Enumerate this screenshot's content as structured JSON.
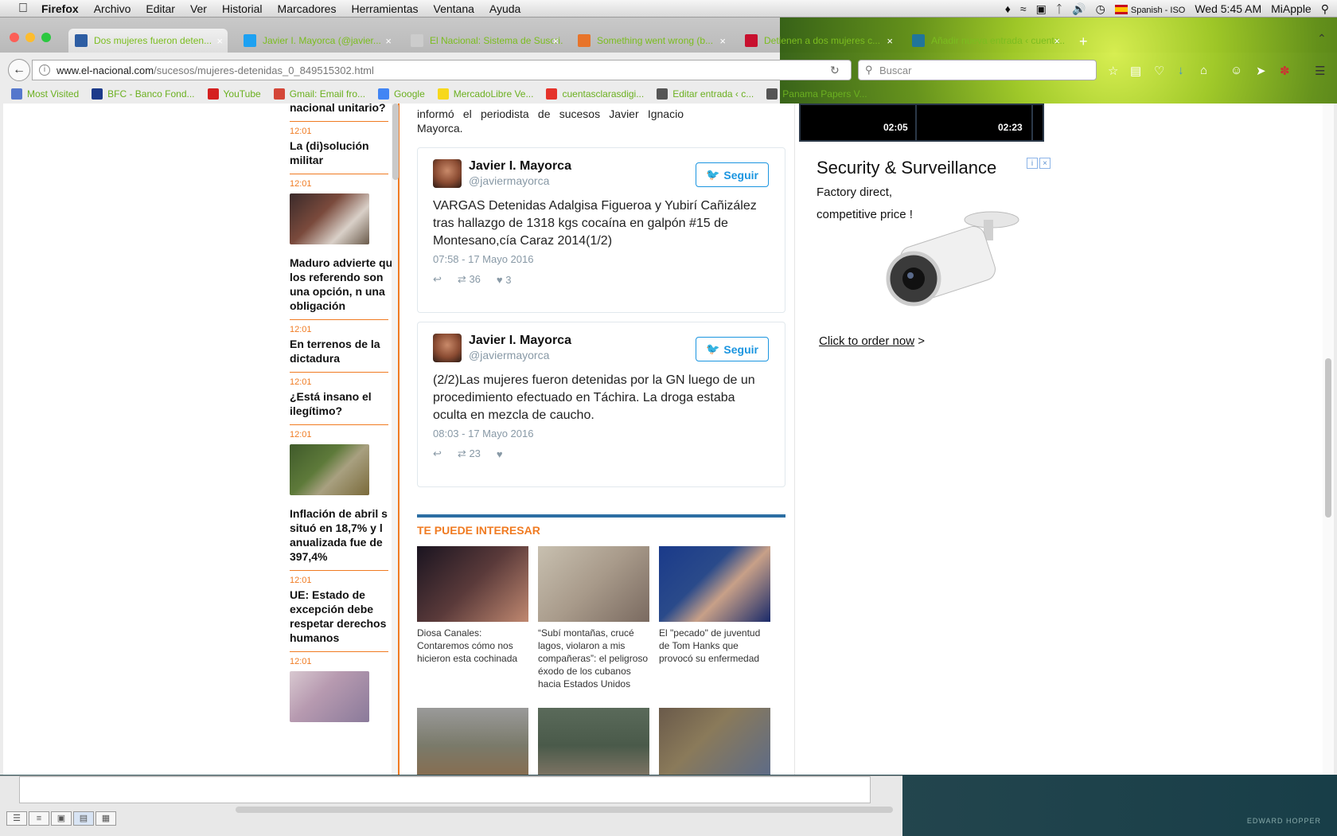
{
  "menubar": {
    "app": "Firefox",
    "items": [
      "Archivo",
      "Editar",
      "Ver",
      "Historial",
      "Marcadores",
      "Herramientas",
      "Ventana",
      "Ayuda"
    ],
    "input_source": "Spanish - ISO",
    "clock": "Wed 5:45 AM",
    "user": "MiApple"
  },
  "tabs": [
    {
      "label": "Dos mujeres fueron deten...",
      "color": "#2e5ea3"
    },
    {
      "label": "Javier I. Mayorca (@javier...",
      "color": "#1da1f2"
    },
    {
      "label": "El Nacional: Sistema de Suscri...",
      "color": "#cccccc"
    },
    {
      "label": "Something went wrong (b...",
      "color": "#e8742a"
    },
    {
      "label": "Detienen a dos mujeres c...",
      "color": "#c8102e"
    },
    {
      "label": "Añadir nueva entrada ‹ cuenta...",
      "color": "#21759b"
    }
  ],
  "url": {
    "host": "www.el-nacional.com",
    "path": "/sucesos/mujeres-detenidas_0_849515302.html"
  },
  "search_placeholder": "Buscar",
  "bookmarks": [
    {
      "label": "Most Visited",
      "color": "#5577cc"
    },
    {
      "label": "BFC - Banco Fond...",
      "color": "#1c3a8a"
    },
    {
      "label": "YouTube",
      "color": "#d42020"
    },
    {
      "label": "Gmail: Email fro...",
      "color": "#d44638"
    },
    {
      "label": "Google",
      "color": "#4285f4"
    },
    {
      "label": "MercadoLibre Ve...",
      "color": "#f7d81c"
    },
    {
      "label": "cuentasclarasdigi...",
      "color": "#e5332a"
    },
    {
      "label": "Editar entrada ‹ c...",
      "color": "#555555"
    },
    {
      "label": "Panama Papers V...",
      "color": "#555555"
    }
  ],
  "sidebar_news": [
    {
      "time": "",
      "title": "nacional unitario?",
      "thumb": ""
    },
    {
      "time": "12:01",
      "title": "La (di)solución militar",
      "thumb": ""
    },
    {
      "time": "12:01",
      "title": "Maduro advierte que los referendo son una opción, n una obligación",
      "thumb": "#7a4a3c"
    },
    {
      "time": "12:01",
      "title": "En terrenos de la dictadura",
      "thumb": ""
    },
    {
      "time": "12:01",
      "title": "¿Está insano el ilegítimo?",
      "thumb": ""
    },
    {
      "time": "12:01",
      "title": "Inflación de abril s situó en 18,7% y l anualizada fue de 397,4%",
      "thumb": "#5e7a3a"
    },
    {
      "time": "12:01",
      "title": "UE: Estado de excepción debe respetar derechos humanos",
      "thumb": ""
    },
    {
      "time": "12:01",
      "title": "",
      "thumb": "#b79ab0"
    }
  ],
  "article": {
    "intro": "fueron hallados en una mezcla de caucho. Así lo informó el periodista de sucesos Javier Ignacio Mayorca."
  },
  "tweets": [
    {
      "name": "Javier I. Mayorca",
      "handle": "@javiermayorca",
      "follow": "Seguir",
      "text": "VARGAS Detenidas Adalgisa Figueroa y Yubirí Cañizález tras hallazgo de 1318 kgs cocaína en galpón #15 de Montesano,cía Caraz 2014(1/2)",
      "date": "07:58 - 17 Mayo 2016",
      "retweets": "36",
      "likes": "3"
    },
    {
      "name": "Javier I. Mayorca",
      "handle": "@javiermayorca",
      "follow": "Seguir",
      "text": "(2/2)Las mujeres fueron detenidas por la GN luego de un procedimiento efectuado en Táchira. La droga estaba oculta en mezcla de caucho.",
      "date": "08:03 - 17 Mayo 2016",
      "retweets": "23",
      "likes": ""
    }
  ],
  "related": {
    "title": "TE PUEDE INTERESAR",
    "cards": [
      {
        "caption": "Diosa Canales: Contaremos cómo nos hicieron esta cochinada",
        "color": "#3a2a3a"
      },
      {
        "caption": "“Subí montañas, crucé lagos, violaron a mis compañeras”: el peligroso éxodo de los cubanos hacia Estados Unidos",
        "color": "#a89a8a"
      },
      {
        "caption": "El \"pecado\" de juventud de Tom Hanks que provocó su enfermedad",
        "color": "#2a4a8a"
      },
      {
        "caption": "",
        "color": "#7a7a6a"
      },
      {
        "caption": "",
        "color": "#4a5a4a"
      },
      {
        "caption": "",
        "color": "#8a7a5a"
      }
    ]
  },
  "video": {
    "time1": "02:05",
    "time2": "02:23"
  },
  "ad": {
    "title": "Security & Surveillance",
    "subtitle": "Factory direct, competitive price !",
    "cta": "Click to order now",
    "cta_suffix": " >"
  },
  "wallpaper_signature": "EDWARD HOPPER"
}
